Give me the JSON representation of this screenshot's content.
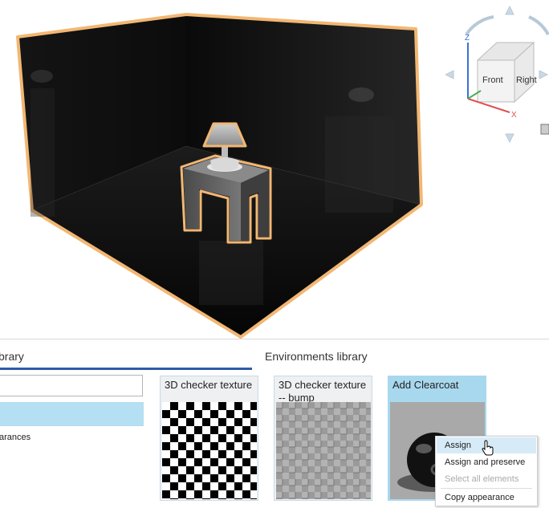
{
  "viewcube": {
    "front_label": "Front",
    "right_label": "Right",
    "axis_z": "Z",
    "axis_x": "X"
  },
  "panel": {
    "appearance_tab_label": "brary",
    "environments_tab_label": "Environments library",
    "list_item_label": "arances"
  },
  "tiles": [
    {
      "title": "3D checker texture"
    },
    {
      "title": "3D checker texture -- bump"
    },
    {
      "title": "Add Clearcoat"
    }
  ],
  "context_menu": {
    "items": [
      {
        "label": "Assign",
        "enabled": true
      },
      {
        "label": "Assign and preserve",
        "enabled": true
      },
      {
        "label": "Select all elements",
        "enabled": false
      },
      {
        "label": "Copy appearance",
        "enabled": true
      }
    ]
  },
  "colors": {
    "selection_outline": "#f2b773",
    "tab_accent": "#2e5ca8",
    "selected_row": "#b5dff2",
    "tile_highlight": "#a8d8ee"
  }
}
